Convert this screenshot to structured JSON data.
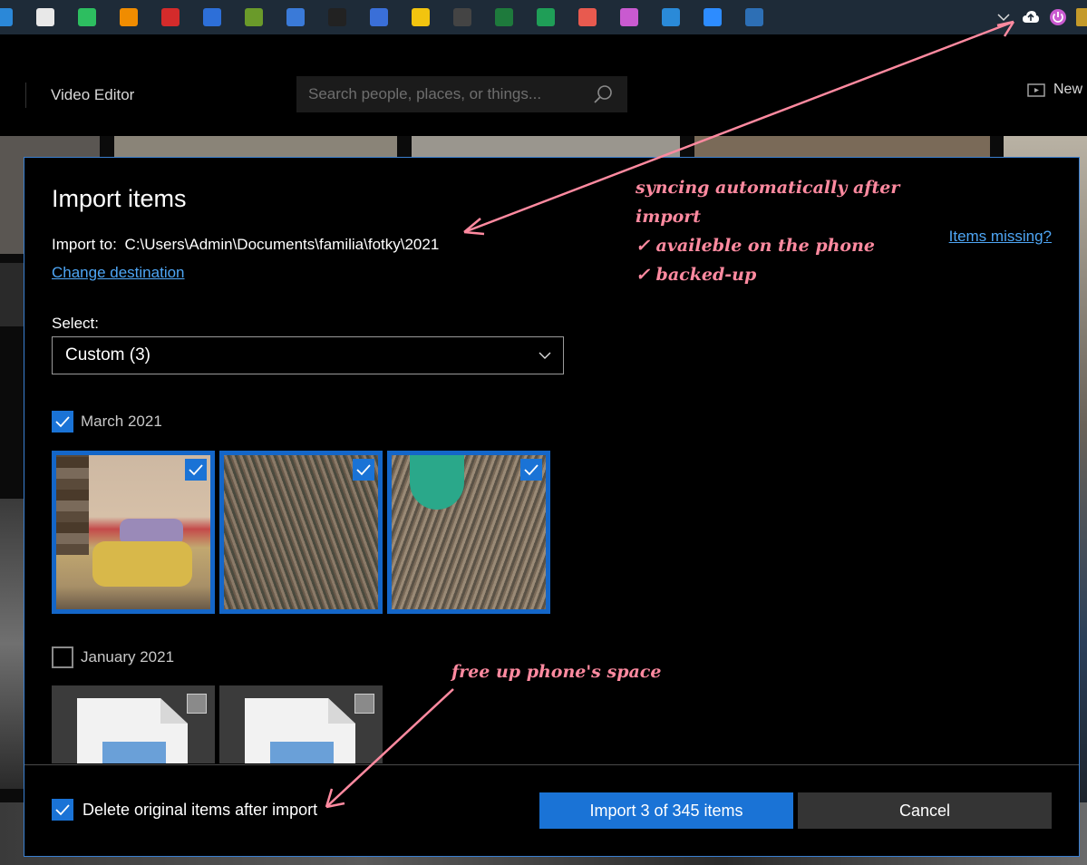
{
  "app": {
    "title": "Video Editor",
    "search_placeholder": "Search people, places, or things...",
    "new_label": "New"
  },
  "taskbar": {
    "icons": [
      {
        "name": "mail-icon",
        "color": "#2b88d8"
      },
      {
        "name": "slack-icon",
        "color": "#e8e8e8"
      },
      {
        "name": "evernote-icon",
        "color": "#2dbe60"
      },
      {
        "name": "vlc-icon",
        "color": "#f08c00"
      },
      {
        "name": "asterisk-app-icon",
        "color": "#d42b2b"
      },
      {
        "name": "trello-icon",
        "color": "#2d6fd8"
      },
      {
        "name": "film-app-icon",
        "color": "#6a9a2a"
      },
      {
        "name": "keyboard-app-icon",
        "color": "#3a7ad8"
      },
      {
        "name": "p-app-icon",
        "color": "#222222"
      },
      {
        "name": "calendar-icon",
        "color": "#3a6fd8"
      },
      {
        "name": "norton-icon",
        "color": "#f2c40f"
      },
      {
        "name": "terminal-icon",
        "color": "#444444"
      },
      {
        "name": "excel-icon",
        "color": "#1e7a3c"
      },
      {
        "name": "sheets-icon",
        "color": "#1f9e57"
      },
      {
        "name": "chat-app-icon",
        "color": "#e85a4f"
      },
      {
        "name": "power-app-icon",
        "color": "#c95ad0"
      },
      {
        "name": "phone-app-icon",
        "color": "#2a8ad8"
      },
      {
        "name": "zoom-icon",
        "color": "#2d8cff"
      },
      {
        "name": "photos-app-icon",
        "color": "#2d6fb5"
      }
    ]
  },
  "dialog": {
    "title": "Import items",
    "import_to_label": "Import to:",
    "import_to_path": "C:\\Users\\Admin\\Documents\\familia\\fotky\\2021",
    "change_destination": "Change destination",
    "items_missing": "Items missing?",
    "select_label": "Select:",
    "select_value": "Custom (3)",
    "groups": [
      {
        "label": "March 2021",
        "checked": true
      },
      {
        "label": "January 2021",
        "checked": false
      }
    ],
    "delete_label": "Delete original items after import",
    "delete_checked": true,
    "import_button": "Import 3 of 345 items",
    "cancel_button": "Cancel"
  },
  "annotations": {
    "sync_lines": [
      "syncing automatically after",
      "import",
      "✓ availeble on the phone",
      "✓ backed-up"
    ],
    "free_space": "free up phone's space"
  },
  "colors": {
    "accent": "#1a73d6",
    "annotation": "#ff8aa0",
    "link": "#4ea6f5"
  }
}
